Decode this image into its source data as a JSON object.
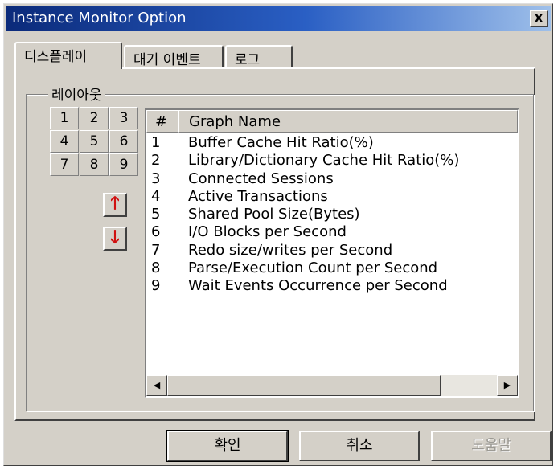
{
  "window": {
    "title": "Instance Monitor Option",
    "close_glyph": "X"
  },
  "tabs": [
    {
      "label": "디스플레이",
      "active": true
    },
    {
      "label": "대기 이벤트",
      "active": false
    },
    {
      "label": "로그",
      "active": false
    }
  ],
  "layout_group": {
    "label": "레이아웃",
    "grid": [
      "1",
      "2",
      "3",
      "4",
      "5",
      "6",
      "7",
      "8",
      "9"
    ],
    "move_up_icon": "up-arrow-icon",
    "move_down_icon": "down-arrow-icon",
    "arrow_color": "#d01010"
  },
  "graph_list": {
    "columns": [
      "#",
      "Graph Name"
    ],
    "rows": [
      {
        "num": "1",
        "name": "Buffer Cache Hit Ratio(%)"
      },
      {
        "num": "2",
        "name": "Library/Dictionary Cache Hit Ratio(%)"
      },
      {
        "num": "3",
        "name": "Connected Sessions"
      },
      {
        "num": "4",
        "name": "Active Transactions"
      },
      {
        "num": "5",
        "name": "Shared Pool Size(Bytes)"
      },
      {
        "num": "6",
        "name": "I/O Blocks per Second"
      },
      {
        "num": "7",
        "name": "Redo size/writes per Second"
      },
      {
        "num": "8",
        "name": "Parse/Execution Count per Second"
      },
      {
        "num": "9",
        "name": "Wait Events Occurrence per Second"
      }
    ]
  },
  "buttons": {
    "ok": "확인",
    "cancel": "취소",
    "help": "도움말"
  }
}
